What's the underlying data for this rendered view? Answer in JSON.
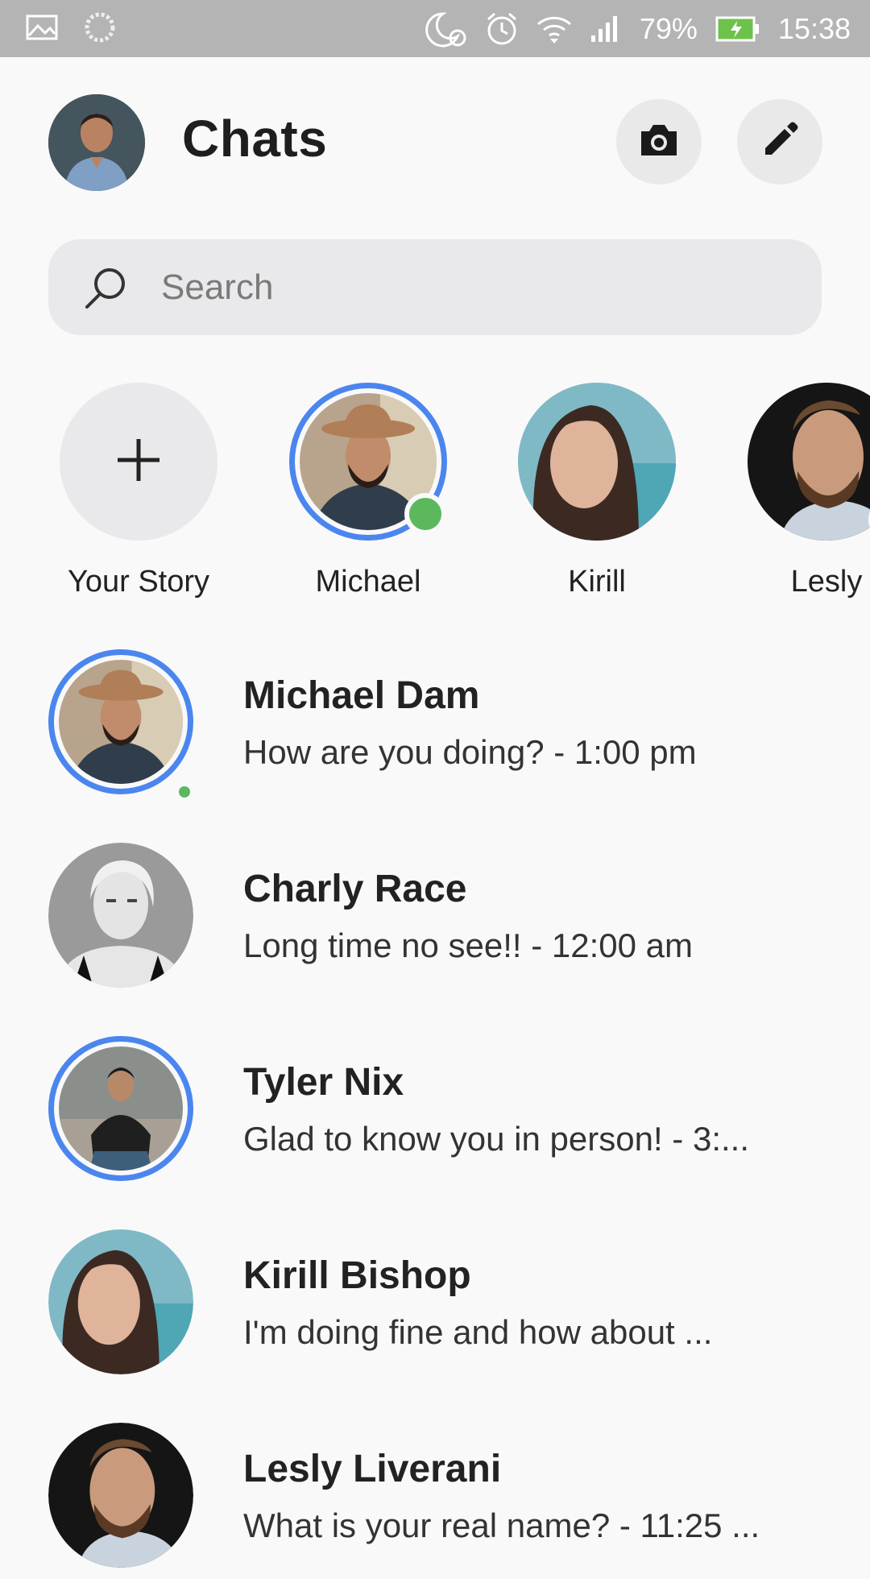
{
  "status_bar": {
    "battery": "79%",
    "time": "15:38",
    "icons": [
      "gallery-icon",
      "loading-icon",
      "moon-alarm-icon",
      "alarm-icon",
      "wifi-icon",
      "signal-icon",
      "battery-icon"
    ]
  },
  "header": {
    "title": "Chats",
    "camera_icon": "camera-icon",
    "edit_icon": "pencil-icon"
  },
  "search": {
    "placeholder": "Search"
  },
  "stories": [
    {
      "name": "Your Story",
      "type": "add"
    },
    {
      "name": "Michael",
      "active": true,
      "online": true
    },
    {
      "name": "Kirill",
      "active": false,
      "online": false
    },
    {
      "name": "Lesly",
      "active": false,
      "online": true
    }
  ],
  "chats": [
    {
      "name": "Michael Dam",
      "message": "How are you doing? - 1:00 pm",
      "active": true
    },
    {
      "name": "Charly Race",
      "message": "Long time no see!! - 12:00 am",
      "active": false
    },
    {
      "name": "Tyler Nix",
      "message": "Glad to know you in person! - 3:...",
      "active": true
    },
    {
      "name": "Kirill Bishop",
      "message": "I'm doing fine and how about ...",
      "active": false
    },
    {
      "name": "Lesly Liverani",
      "message": "What is your real name? - 11:25 ...",
      "active": false
    }
  ],
  "colors": {
    "accent": "#4b86ee",
    "online": "#5cb85c",
    "status_bar": "#b4b4b4",
    "background": "#f9f9fa"
  }
}
